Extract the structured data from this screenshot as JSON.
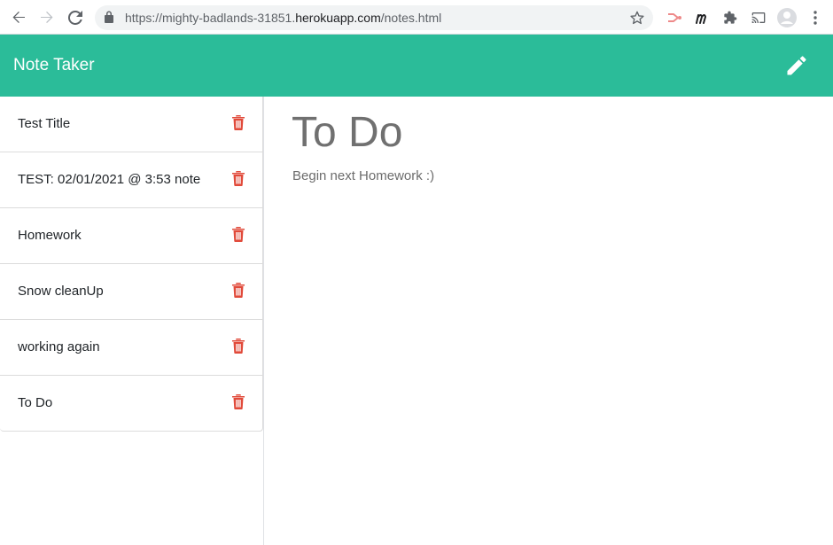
{
  "browser": {
    "url_prefix": "https://mighty-badlands-31851.",
    "url_domain": "herokuapp.com",
    "url_path": "/notes.html"
  },
  "app": {
    "brand": "Note Taker",
    "accent_color": "#2bbc99",
    "delete_color": "#e14a3a",
    "new_note_icon": "pencil-icon"
  },
  "notes": [
    {
      "title": "Test Title"
    },
    {
      "title": "TEST: 02/01/2021 @ 3:53 note"
    },
    {
      "title": "Homework"
    },
    {
      "title": "Snow cleanUp"
    },
    {
      "title": "working again"
    },
    {
      "title": "To Do"
    }
  ],
  "active_note": {
    "title": "To Do",
    "text": "Begin next Homework :)"
  }
}
